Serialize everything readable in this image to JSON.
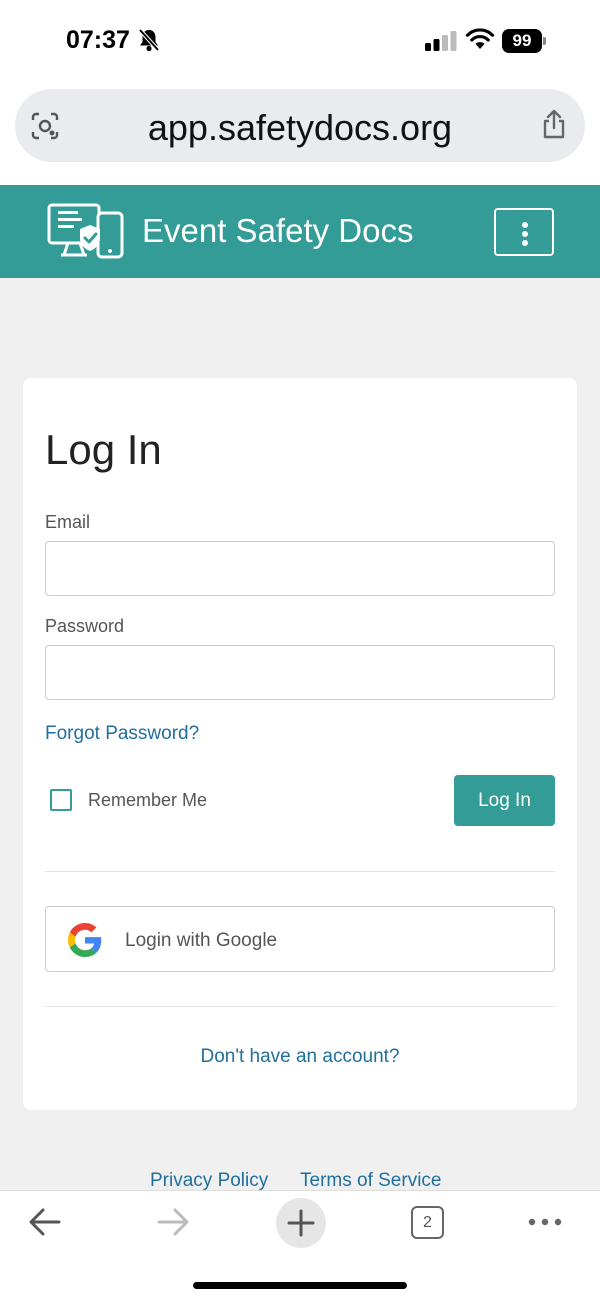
{
  "status_bar": {
    "time": "07:37",
    "battery_level": "99",
    "icons": [
      "bell-slash-icon",
      "cellular-signal-icon",
      "wifi-icon",
      "battery-icon"
    ]
  },
  "browser": {
    "url": "app.safetydocs.org",
    "tabs_count": "2",
    "toolbar_icons": [
      "back-arrow-icon",
      "forward-arrow-icon",
      "plus-icon",
      "tabs-icon",
      "more-icon"
    ]
  },
  "app_header": {
    "title": "Event Safety Docs",
    "logo_icon": "devices-shield-icon",
    "menu_icon": "vertical-dots-icon",
    "color": "#339c96"
  },
  "login_form": {
    "title": "Log In",
    "email_label": "Email",
    "email_value": "",
    "password_label": "Password",
    "password_value": "",
    "forgot_password": "Forgot Password?",
    "remember_me": "Remember Me",
    "remember_checked": false,
    "submit_label": "Log In",
    "google_label": "Login with Google",
    "signup_link": "Don't have an account?"
  },
  "footer": {
    "privacy": "Privacy Policy",
    "terms": "Terms of Service"
  },
  "colors": {
    "accent": "#339c96",
    "link": "#1f6f9e",
    "page_background": "#f0f0f0"
  }
}
